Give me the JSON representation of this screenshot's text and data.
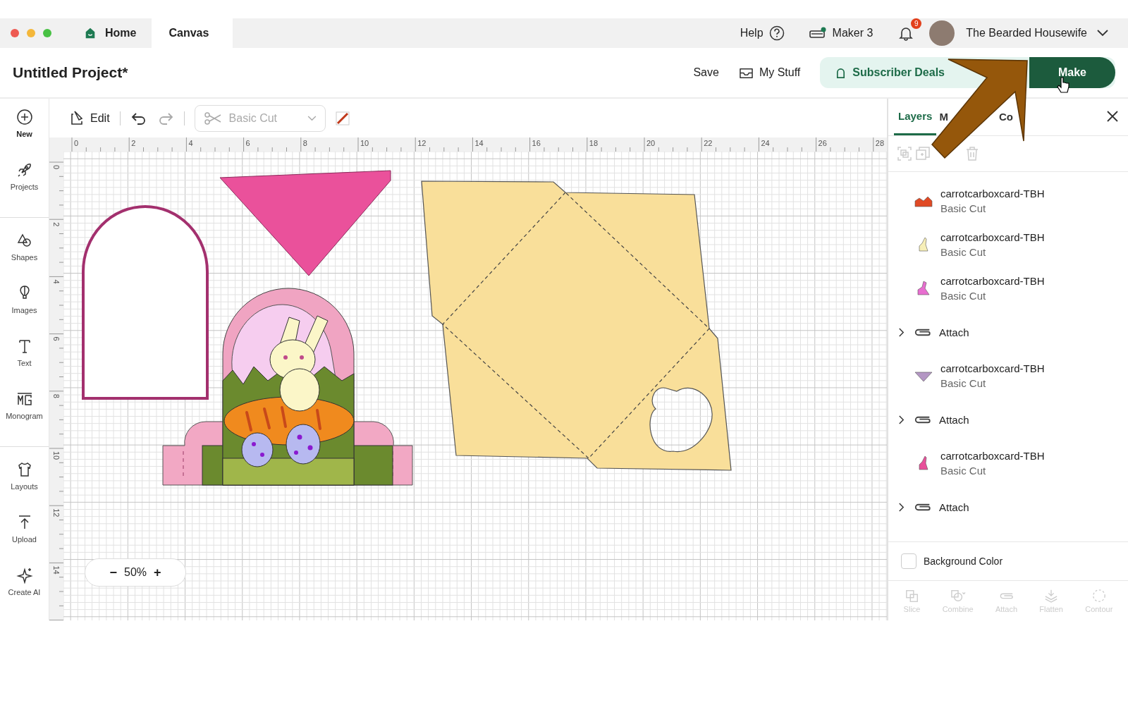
{
  "tabs": [
    {
      "label": "Home",
      "selected": false
    },
    {
      "label": "Canvas",
      "selected": true
    }
  ],
  "top_bar": {
    "help": "Help",
    "machine": "Maker 3",
    "notifications": "9",
    "user": "The Bearded Housewife"
  },
  "header": {
    "title": "Untitled Project*",
    "save": "Save",
    "my_stuff": "My Stuff",
    "subscriber_deals": "Subscriber Deals",
    "make": "Make"
  },
  "toolbar": {
    "edit": "Edit",
    "operation": {
      "value": "Basic Cut",
      "disabled": true
    }
  },
  "sidebar": {
    "groups": [
      [
        {
          "label": "New"
        },
        {
          "label": "Projects"
        }
      ],
      [
        {
          "label": "Shapes"
        },
        {
          "label": "Images"
        },
        {
          "label": "Text"
        },
        {
          "label": "Monogram"
        }
      ],
      [
        {
          "label": "Layouts"
        },
        {
          "label": "Upload"
        },
        {
          "label": "Create AI"
        }
      ]
    ]
  },
  "rulers": {
    "horizontal": [
      "0",
      "2",
      "4",
      "6",
      "8",
      "10",
      "12",
      "14",
      "16",
      "18",
      "20",
      "22",
      "24",
      "26",
      "28"
    ],
    "vertical": [
      "0",
      "2",
      "4",
      "6",
      "8",
      "10",
      "12",
      "14"
    ]
  },
  "zoom": {
    "decrease": "−",
    "value": "50%",
    "increase": "+"
  },
  "layers_panel": {
    "tabs": [
      {
        "label": "Layers",
        "selected": true
      },
      {
        "label": "M",
        "selected": false
      },
      {
        "label": "Co",
        "selected": false
      }
    ],
    "layers": [
      {
        "kind": "layer",
        "name": "carrotcarboxcard-TBH",
        "operation": "Basic Cut",
        "color": "#e04a25"
      },
      {
        "kind": "layer",
        "name": "carrotcarboxcard-TBH",
        "operation": "Basic Cut",
        "color": "#f7efb8"
      },
      {
        "kind": "layer",
        "name": "carrotcarboxcard-TBH",
        "operation": "Basic Cut",
        "color": "#e86ed0"
      },
      {
        "kind": "group",
        "name": "Attach",
        "expanded": false
      },
      {
        "kind": "layer",
        "name": "carrotcarboxcard-TBH",
        "operation": "Basic Cut",
        "color": "#b497c4"
      },
      {
        "kind": "group",
        "name": "Attach",
        "expanded": false
      },
      {
        "kind": "layer",
        "name": "carrotcarboxcard-TBH",
        "operation": "Basic Cut",
        "color": "#e84f9a"
      },
      {
        "kind": "group",
        "name": "Attach",
        "expanded": false
      }
    ],
    "background_color": {
      "label": "Background Color",
      "checked": false
    },
    "actions": [
      {
        "label": "Slice",
        "disabled": true
      },
      {
        "label": "Combine",
        "disabled": true
      },
      {
        "label": "Attach",
        "disabled": true
      },
      {
        "label": "Flatten",
        "disabled": true
      },
      {
        "label": "Contour",
        "disabled": true
      }
    ]
  }
}
